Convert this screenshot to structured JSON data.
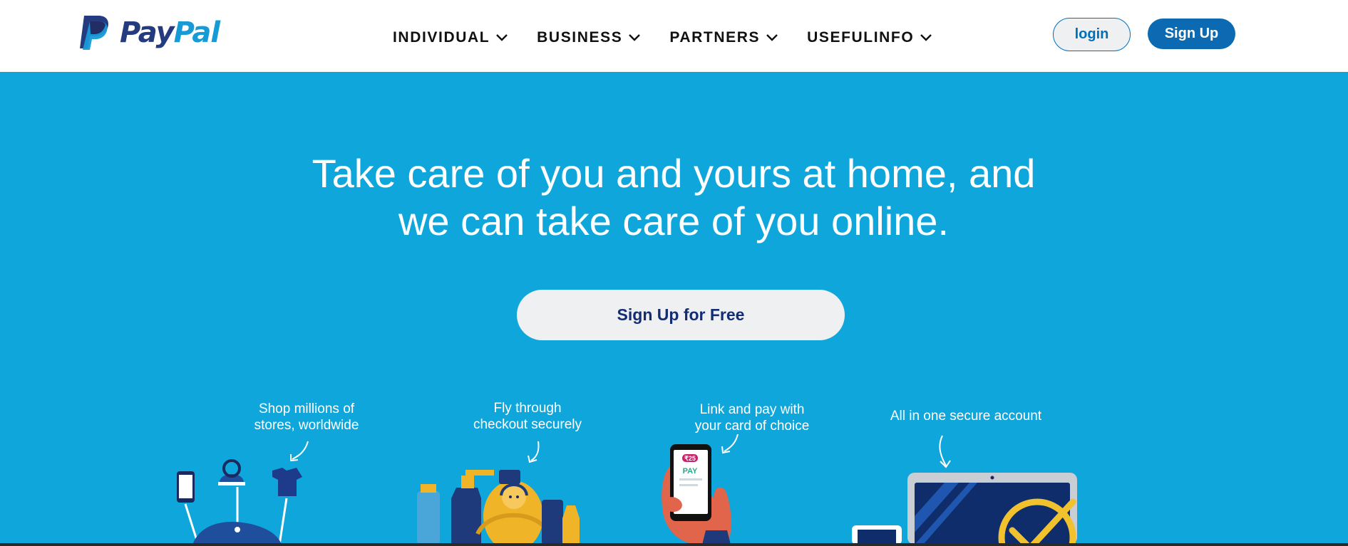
{
  "header": {
    "brand": {
      "part1": "Pay",
      "part2": "Pal"
    },
    "nav": [
      {
        "label": "INDIVIDUAL"
      },
      {
        "label": "BUSINESS"
      },
      {
        "label": "PARTNERS"
      },
      {
        "label": "USEFULINFO"
      }
    ],
    "login_label": "login",
    "signup_label": "Sign Up"
  },
  "hero": {
    "title_line1": "Take care of you and yours at home, and",
    "title_line2": "we can take care of you online.",
    "cta_label": "Sign Up for Free"
  },
  "features": [
    {
      "line1": "Shop millions of",
      "line2": "stores, worldwide"
    },
    {
      "line1": "Fly through",
      "line2": "checkout securely"
    },
    {
      "line1": "Link and pay with",
      "line2": "your card of choice",
      "phone_badge": "₹25",
      "phone_pay": "PAY"
    },
    {
      "line1": "All in one secure account"
    }
  ],
  "colors": {
    "hero_bg": "#0fa7db",
    "brand_dark": "#253b80",
    "brand_light": "#179bd7",
    "primary_button": "#0b6ab2",
    "cta_text": "#142c74"
  }
}
